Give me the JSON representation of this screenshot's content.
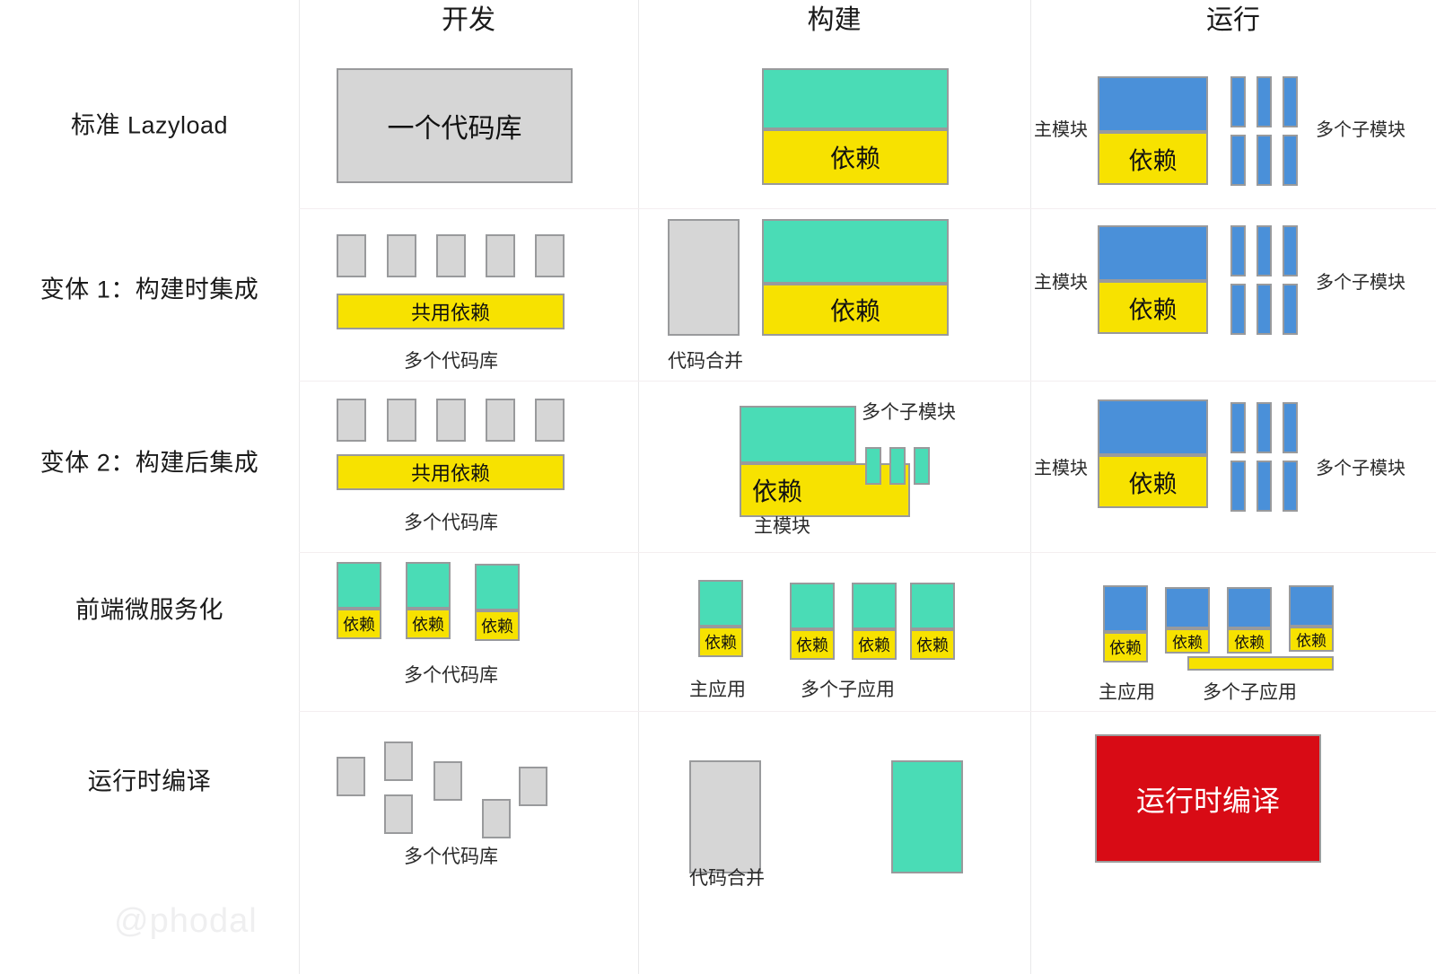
{
  "columns": [
    {
      "key": "dev",
      "label": "开发"
    },
    {
      "key": "build",
      "label": "构建"
    },
    {
      "key": "run",
      "label": "运行"
    }
  ],
  "rows": [
    {
      "key": "standard",
      "label": "标准 Lazyload"
    },
    {
      "key": "variant1",
      "label": "变体 1：构建时集成"
    },
    {
      "key": "variant2",
      "label": "变体 2：构建后集成"
    },
    {
      "key": "microfrontend",
      "label": "前端微服务化"
    },
    {
      "key": "runtime_compile",
      "label": "运行时编译"
    }
  ],
  "labels": {
    "one_repo": "一个代码库",
    "many_repos": "多个代码库",
    "dependency": "依赖",
    "shared_dependency": "共用依赖",
    "code_merge": "代码合并",
    "main_module": "主模块",
    "many_submodules": "多个子模块",
    "main_app": "主应用",
    "many_subapps": "多个子应用",
    "runtime_compile": "运行时编译"
  },
  "watermark": "@phodal",
  "colors": {
    "gray": "#d6d6d6",
    "green": "#4adcb6",
    "yellow": "#f7e200",
    "blue": "#4a90d9",
    "red": "#d80b15",
    "border": "#999a9c",
    "gridline": "#e9e9ea"
  }
}
